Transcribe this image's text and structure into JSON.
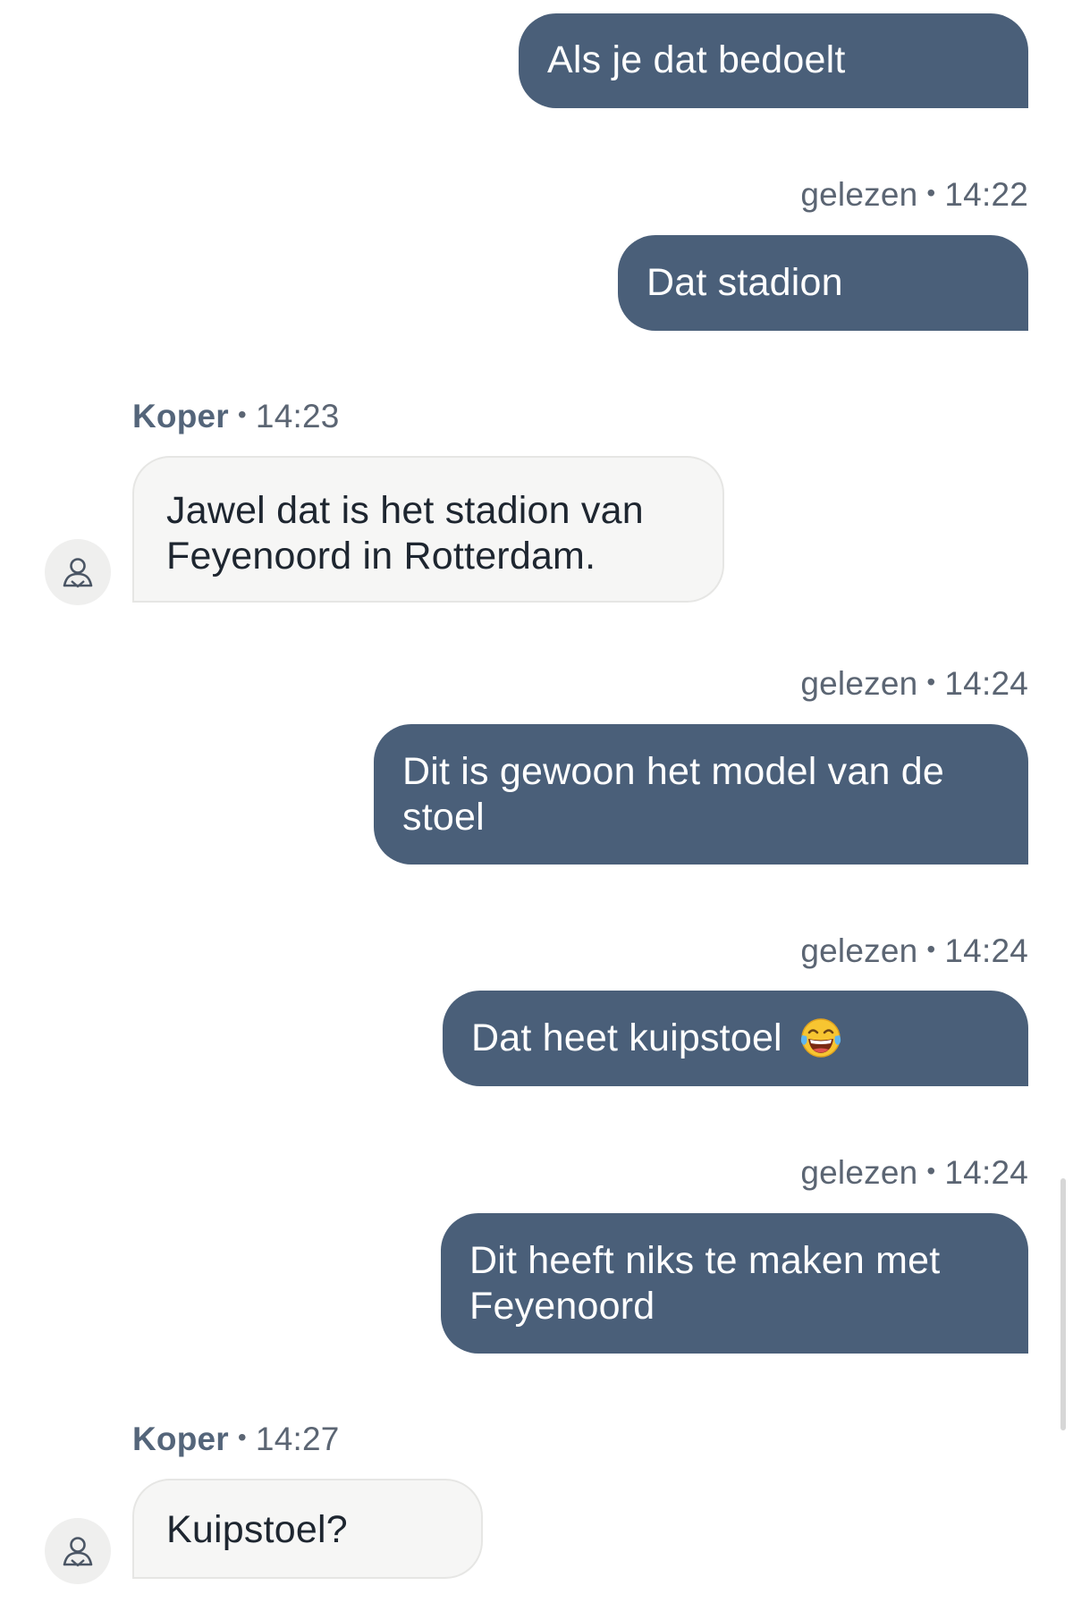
{
  "messages": [
    {
      "direction": "out",
      "text": "Als je dat bedoelt"
    },
    {
      "direction": "out",
      "status": "gelezen",
      "time": "14:22",
      "text": "Dat stadion"
    },
    {
      "direction": "in",
      "sender": "Koper",
      "time": "14:23",
      "text_line1": "Jawel dat is het stadion van",
      "text_line2": "Feyenoord in Rotterdam."
    },
    {
      "direction": "out",
      "status": "gelezen",
      "time": "14:24",
      "text_line1": "Dit is gewoon het model van de",
      "text_line2": "stoel"
    },
    {
      "direction": "out",
      "status": "gelezen",
      "time": "14:24",
      "text": "Dat heet kuipstoel",
      "emoji": "face-with-tears-of-joy"
    },
    {
      "direction": "out",
      "status": "gelezen",
      "time": "14:24",
      "text_line1": "Dit heeft niks te maken met",
      "text_line2": "Feyenoord"
    },
    {
      "direction": "in",
      "sender": "Koper",
      "time": "14:27",
      "text": "Kuipstoel?"
    }
  ],
  "separator": "•",
  "colors": {
    "outgoing_bubble": "#4a5f79",
    "incoming_bubble": "#f6f6f5",
    "meta_text": "#5b6573"
  },
  "icons": {
    "avatar": "user-avatar-icon"
  }
}
